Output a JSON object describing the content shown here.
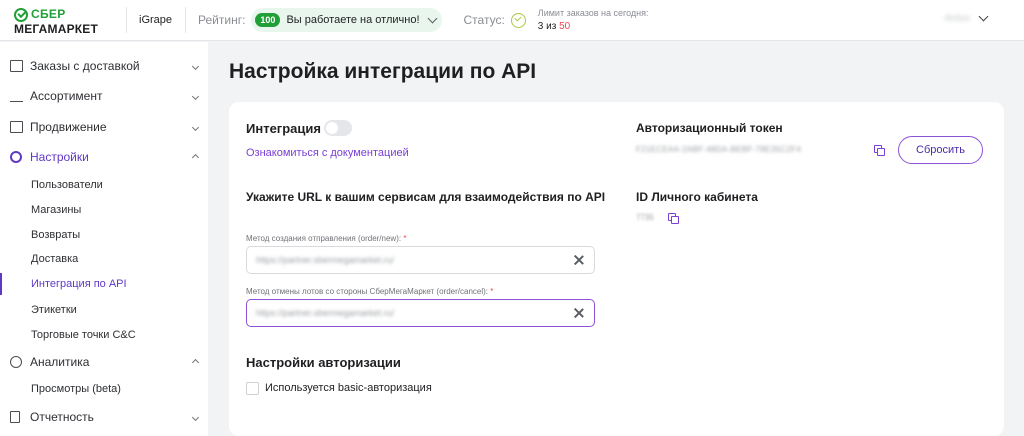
{
  "header": {
    "logo_line1": "СБЕР",
    "logo_line2": "МЕГАМАРКЕТ",
    "shop_name": "iGrape",
    "rating_label": "Рейтинг:",
    "rating_score": "100",
    "rating_text": "Вы работаете на отлично!",
    "status_label": "Статус:",
    "limit_label": "Лимит заказов на сегодня:",
    "limit_current": "3 из ",
    "limit_max": "50",
    "user_name": "Antox"
  },
  "sidebar": {
    "items": [
      {
        "label": "Заказы с доставкой",
        "icon": "truck-icon"
      },
      {
        "label": "Ассортимент",
        "icon": "cart-icon"
      },
      {
        "label": "Продвижение",
        "icon": "promo-icon"
      },
      {
        "label": "Настройки",
        "icon": "gear-icon"
      },
      {
        "label": "Аналитика",
        "icon": "pie-chart-icon"
      },
      {
        "label": "Отчетность",
        "icon": "document-icon"
      }
    ],
    "settings_sub": [
      "Пользователи",
      "Магазины",
      "Возвраты",
      "Доставка",
      "Интеграция по API",
      "Этикетки",
      "Торговые точки C&C"
    ],
    "analytics_sub": [
      "Просмотры (beta)"
    ]
  },
  "main": {
    "title": "Настройка интеграции по API",
    "integration_label": "Интеграция",
    "docs_link": "Ознакомиться с документацией",
    "url_section_title": "Укажите URL к вашим сервисам для взаимодействия по API",
    "field_new_label": "Метод создания отправления (order/new):",
    "field_new_value": "https://partner.sbermegamarket.ru/",
    "field_cancel_label": "Метод отмены лотов со стороны СберМегаМаркет (order/cancel):",
    "field_cancel_value": "https://partner.sbermegamarket.ru/",
    "required_mark": " *",
    "auth_section_title": "Настройки авторизации",
    "basic_auth_label": "Используется basic-авторизация",
    "token_title": "Авторизационный токен",
    "token_value": "F21ECEAA-2ABF-48DA-BEBF-78E35C2F4",
    "reset_button": "Сбросить",
    "cabinet_id_title": "ID Личного кабинета",
    "cabinet_id_value": "7735"
  },
  "colors": {
    "brand_green": "#21a038",
    "accent_purple": "#7a3fd6",
    "required_red": "#f0474c"
  }
}
